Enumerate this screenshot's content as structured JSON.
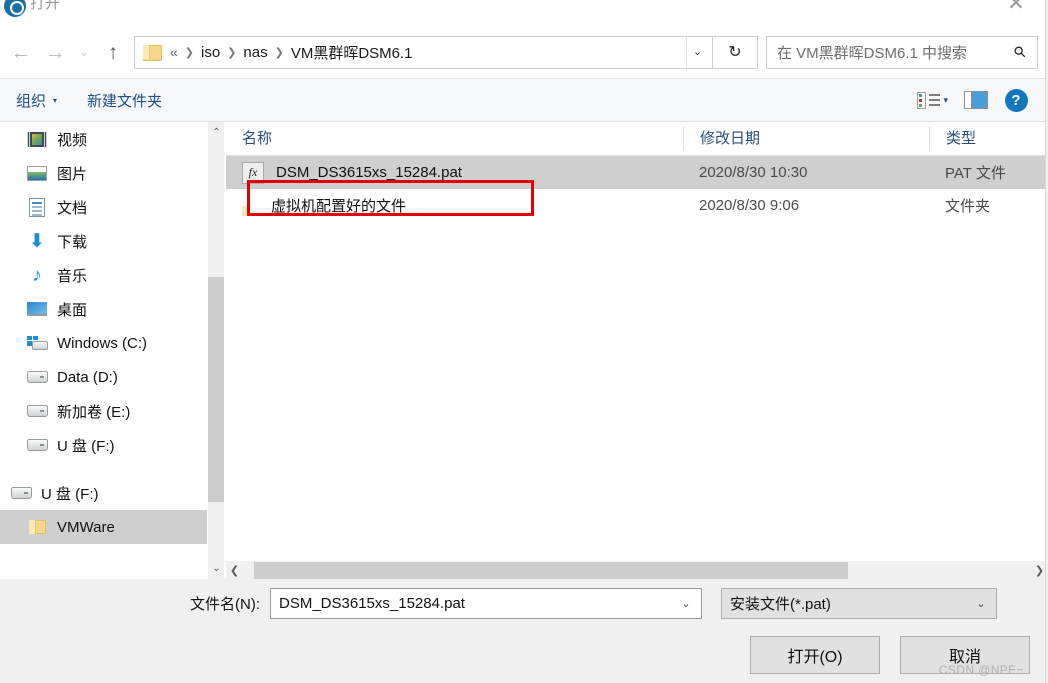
{
  "window": {
    "title": "打开",
    "title_icon": "open-dialog-icon",
    "close_label": "✕"
  },
  "nav": {
    "back": "←",
    "forward": "→",
    "recent": "⌄",
    "up": "↑"
  },
  "address": {
    "folder_icon": "folder-icon",
    "overflow": "«",
    "crumbs": [
      "iso",
      "nas",
      "VM黑群晖DSM6.1"
    ],
    "separator": "❯",
    "dropdown": "⌄",
    "refresh": "↻"
  },
  "search": {
    "placeholder": "在 VM黑群晖DSM6.1 中搜索",
    "icon": "search-icon"
  },
  "toolbar": {
    "organize": "组织",
    "organize_caret": "▾",
    "new_folder": "新建文件夹",
    "view_icon": "list-view-icon",
    "view_caret": "▾",
    "preview_icon": "preview-pane-icon",
    "help_icon": "?"
  },
  "sidebar": {
    "groups": [
      {
        "items": [
          {
            "label": "视频",
            "icon": "video-icon",
            "selected": false,
            "indent": 1
          },
          {
            "label": "图片",
            "icon": "pictures-icon",
            "selected": false,
            "indent": 1
          },
          {
            "label": "文档",
            "icon": "documents-icon",
            "selected": false,
            "indent": 1
          },
          {
            "label": "下载",
            "icon": "downloads-icon",
            "selected": false,
            "indent": 1
          },
          {
            "label": "音乐",
            "icon": "music-icon",
            "selected": false,
            "indent": 1
          },
          {
            "label": "桌面",
            "icon": "desktop-icon",
            "selected": false,
            "indent": 1
          },
          {
            "label": "Windows (C:)",
            "icon": "windows-drive-icon",
            "selected": false,
            "indent": 1
          },
          {
            "label": "Data (D:)",
            "icon": "drive-icon",
            "selected": false,
            "indent": 1
          },
          {
            "label": "新加卷 (E:)",
            "icon": "drive-icon",
            "selected": false,
            "indent": 1
          },
          {
            "label": "U 盘 (F:)",
            "icon": "drive-icon",
            "selected": false,
            "indent": 1
          }
        ]
      },
      {
        "items": [
          {
            "label": "U 盘 (F:)",
            "icon": "drive-icon",
            "selected": false,
            "indent": 0
          },
          {
            "label": "VMWare",
            "icon": "folder-icon",
            "selected": true,
            "indent": 1
          }
        ]
      }
    ],
    "scrollbar": {
      "up": "⌃",
      "down": "⌄"
    }
  },
  "filelist": {
    "columns": [
      "名称",
      "修改日期",
      "类型"
    ],
    "rows": [
      {
        "name": "DSM_DS3615xs_15284.pat",
        "date": "2020/8/30 10:30",
        "type": "PAT 文件",
        "icon": "pat-file-icon",
        "icon_glyph": "fx",
        "selected": true,
        "highlighted": true
      },
      {
        "name": "虚拟机配置好的文件",
        "date": "2020/8/30 9:06",
        "type": "文件夹",
        "icon": "folder-icon",
        "icon_glyph": "",
        "selected": false,
        "highlighted": false
      }
    ],
    "hscroll": {
      "left": "❮",
      "right": "❯"
    }
  },
  "footer": {
    "filename_label": "文件名(N):",
    "filename_value": "DSM_DS3615xs_15284.pat",
    "filename_caret": "⌄",
    "filter_value": "安装文件(*.pat)",
    "filter_caret": "⌄",
    "open_button": "打开(O)",
    "cancel_button": "取消",
    "watermark": "CSDN @NPE~"
  },
  "annotation": {
    "highlight_color": "#e60000"
  }
}
